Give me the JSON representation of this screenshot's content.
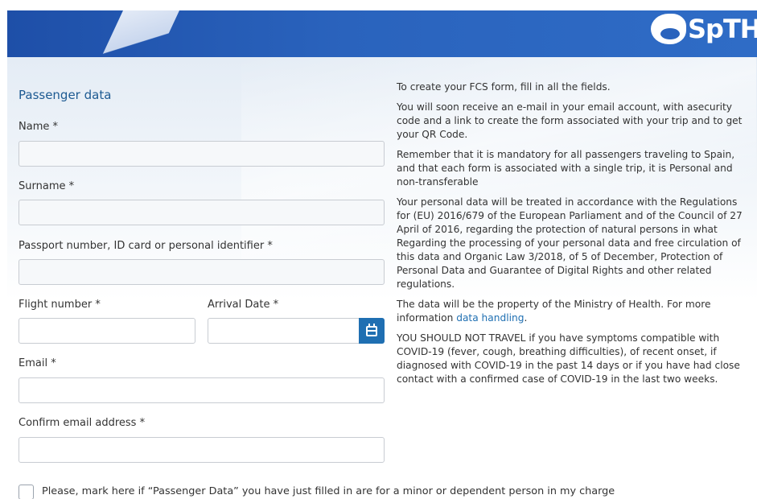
{
  "header": {
    "logo_text": "SpTH"
  },
  "form": {
    "title": "Passenger data",
    "name_label": "Name",
    "surname_label": "Surname",
    "passport_label": "Passport number, ID card or personal identifier",
    "flight_label": "Flight number",
    "arrival_label": "Arrival Date",
    "email_label": "Email",
    "confirm_email_label": "Confirm email address",
    "required_marker": "*",
    "minor_checkbox_label": "Please, mark here if “Passenger Data” you have just filled in are for a minor or dependent person in my charge"
  },
  "info": {
    "p1": "To create your FCS form, fill in all the fields.",
    "p2": "You will soon receive an e-mail in your email account, with asecurity code and a link to create the form associated with your trip and to get your QR Code.",
    "p3": "Remember that it is mandatory for all passengers traveling to Spain, and that each form is associated with a single trip, it is Personal and non-transferable",
    "p4": "Your personal data will be treated in accordance with the Regulations for (EU) 2016/679 of the European Parliament and of the Council of 27 April of 2016, regarding the protection of natural persons in what Regarding the processing of your personal data and free circulation of this data and Organic Law 3/2018, of 5 of December, Protection of Personal Data and Guarantee of Digital Rights and other related regulations.",
    "p5_prefix": "The data will be the property of the Ministry of Health. For more information ",
    "p5_link": "data handling",
    "p5_suffix": ".",
    "p6": "YOU SHOULD NOT TRAVEL if you have symptoms compatible with COVID-19 (fever, cough, breathing difficulties), of recent onset, if diagnosed with COVID-19 in the past 14 days or if you have had close contact with a confirmed case of COVID-19 in the last two weeks."
  },
  "colors": {
    "accent": "#1f6fb2",
    "title": "#1d5a92",
    "header_blue": "#2a63bd"
  },
  "icons": {
    "date_picker": "calendar-icon"
  }
}
